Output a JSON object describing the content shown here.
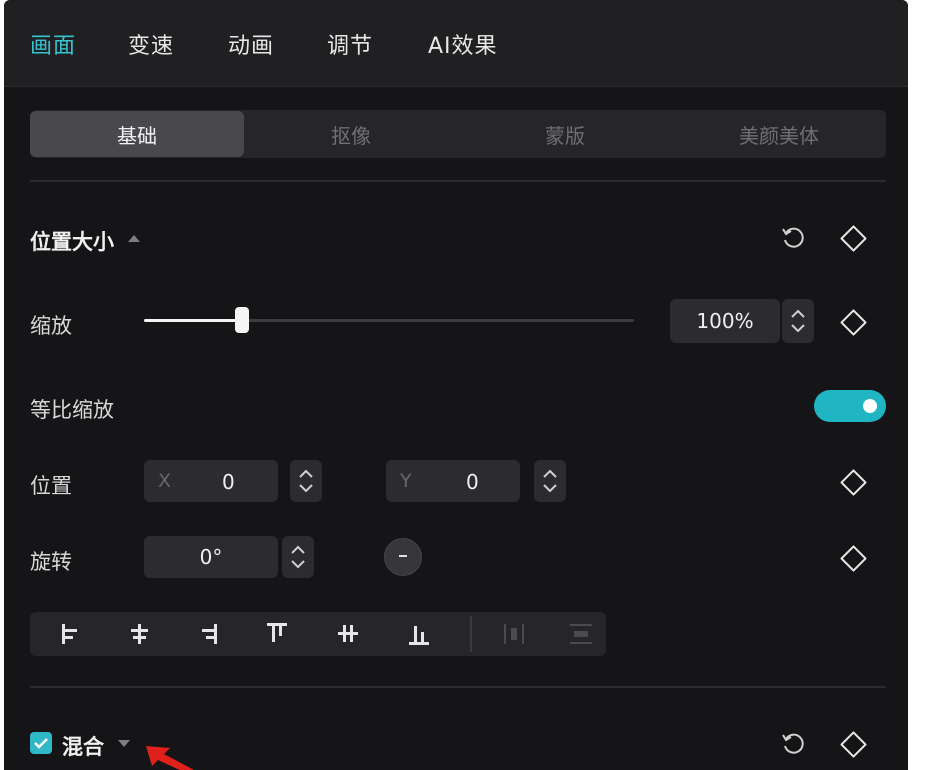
{
  "top_tabs": [
    "画面",
    "变速",
    "动画",
    "调节",
    "AI效果"
  ],
  "active_top_tab": "画面",
  "sub_tabs": [
    "基础",
    "抠像",
    "蒙版",
    "美颜美体"
  ],
  "active_sub_tab": "基础",
  "section_position": {
    "title": "位置大小"
  },
  "scale": {
    "label": "缩放",
    "value": "100%",
    "slider_fraction": 0.2
  },
  "uniform_scale": {
    "label": "等比缩放",
    "enabled": true
  },
  "position": {
    "label": "位置",
    "x_label": "X",
    "x_value": "0",
    "y_label": "Y",
    "y_value": "0"
  },
  "rotation": {
    "label": "旋转",
    "value": "0°"
  },
  "align_icons": [
    "align-left-icon",
    "align-center-h-icon",
    "align-right-icon",
    "align-top-icon",
    "align-center-v-icon",
    "align-bottom-icon",
    "distribute-h-icon",
    "distribute-v-icon"
  ],
  "section_blend": {
    "title": "混合",
    "checked": true
  },
  "colors": {
    "accent": "#38c3d0",
    "toggle_on": "#1fb5c2",
    "panel_bg": "#151518",
    "arrow": "#e0201a"
  }
}
